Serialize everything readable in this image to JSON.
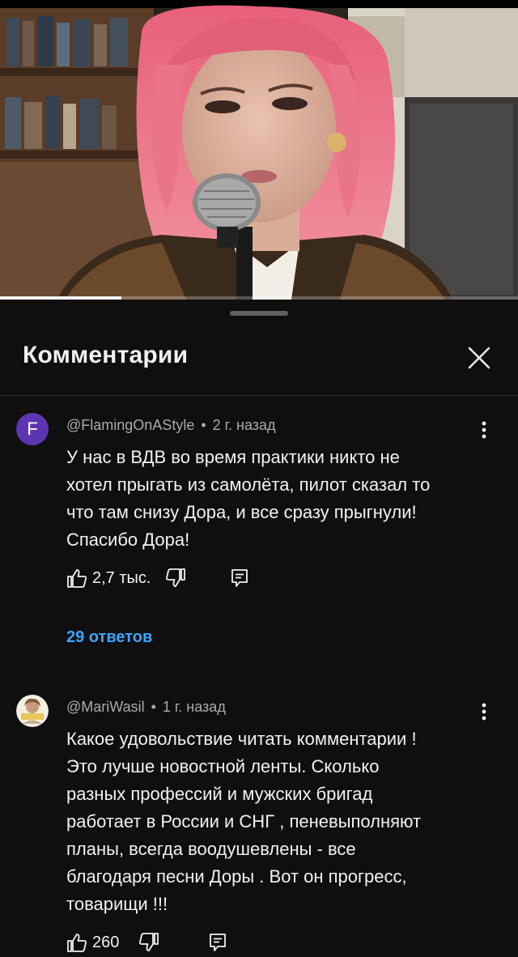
{
  "video": {
    "progress": 0.235
  },
  "sheet": {
    "title": "Комментарии"
  },
  "comments": [
    {
      "avatar_letter": "F",
      "avatar_color": "#5e35b1",
      "author": "@FlamingOnAStyle",
      "separator": "•",
      "time": "2 г. назад",
      "text": "У нас в ВДВ во время практики никто не\nхотел прыгать из самолёта, пилот сказал то\nчто там снизу Дора, и все сразу прыгнули!\nСпасибо Дора!",
      "likes": "2,7 тыс.",
      "replies": "29 ответов"
    },
    {
      "author": "@MariWasil",
      "separator": "•",
      "time": "1 г. назад",
      "text": "Какое удовольствие читать комментарии !\nЭто лучше новостной ленты. Сколько\nразных профессий и мужских бригад\nработает в России и СНГ , пеневыполняют\nпланы, всегда воодушевлены - все\nблагодаря песни Доры . Вот он прогресс,\nтоварищи !!!",
      "likes": "260"
    }
  ],
  "colors": {
    "background": "#0f0f0f",
    "text": "#f1f1f1",
    "secondary_text": "#aaaaaa",
    "link": "#3ea6ff"
  },
  "icons": [
    "close-icon",
    "more-vert-icon",
    "thumb-up-icon",
    "thumb-down-icon",
    "reply-icon"
  ]
}
